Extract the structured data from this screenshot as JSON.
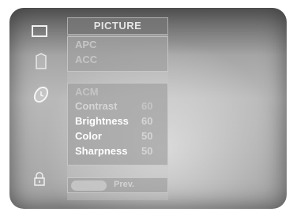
{
  "menu": {
    "title": "PICTURE",
    "group1": [
      "APC",
      "ACC"
    ],
    "group2": [
      {
        "label": "ACM",
        "value": ""
      },
      {
        "label": "Contrast",
        "value": "60"
      },
      {
        "label": "Brightness",
        "value": "60"
      },
      {
        "label": "Color",
        "value": "50"
      },
      {
        "label": "Sharpness",
        "value": "50"
      }
    ],
    "prev_label": "Prev."
  },
  "icons": [
    "screen-icon",
    "speaker-icon",
    "clock-icon",
    "lock-icon"
  ]
}
